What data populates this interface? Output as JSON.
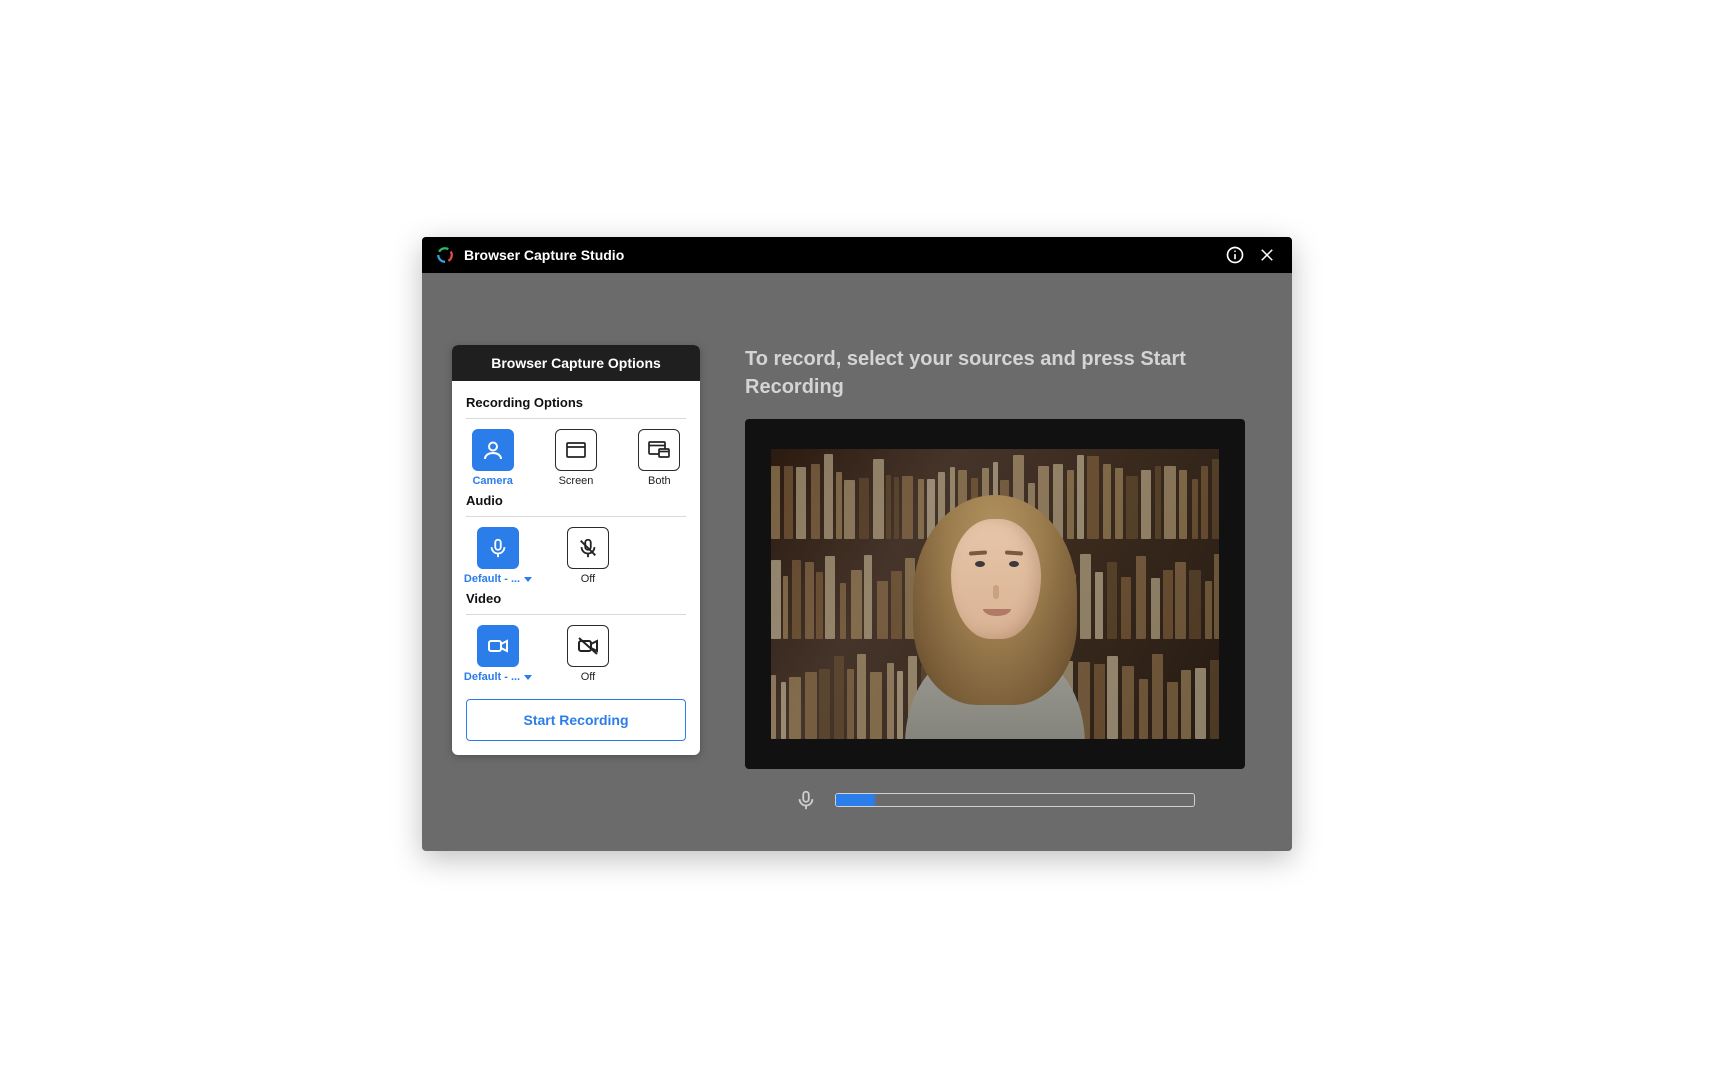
{
  "titlebar": {
    "title": "Browser Capture Studio"
  },
  "panel": {
    "header": "Browser Capture Options",
    "recording_label": "Recording Options",
    "audio_label": "Audio",
    "video_label": "Video",
    "recording": {
      "camera": "Camera",
      "screen": "Screen",
      "both": "Both"
    },
    "audio": {
      "default": "Default - ...",
      "off": "Off"
    },
    "video": {
      "default": "Default - ...",
      "off": "Off"
    },
    "start_button": "Start Recording"
  },
  "preview": {
    "instruction": "To record, select your sources and press Start Recording",
    "mic_level_percent": 11
  }
}
